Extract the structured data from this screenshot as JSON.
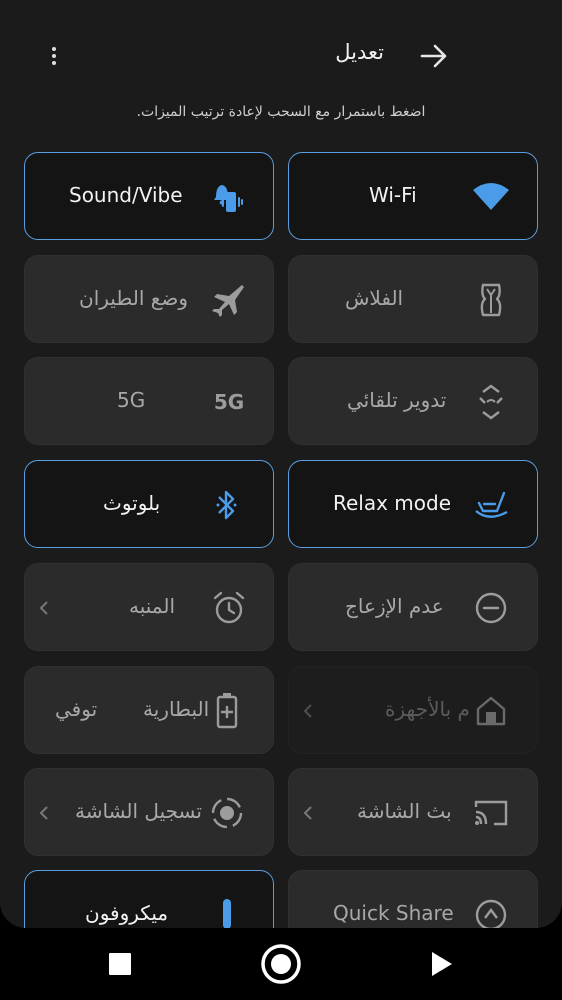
{
  "header": {
    "title": "تعديل",
    "hint": "اضغط باستمرار مع السحب لإعادة ترتيب الميزات."
  },
  "colors": {
    "accent": "#4a9be8",
    "active_border": "#5a9ee0"
  },
  "tiles": {
    "wifi": {
      "label": "Wi-Fi",
      "icon": "wifi-icon",
      "state": "active"
    },
    "sound": {
      "label": "Sound/Vibe",
      "icon": "sound-vibe-icon",
      "state": "active"
    },
    "flash": {
      "label": "الفلاش",
      "icon": "flashlight-icon",
      "state": "inactive"
    },
    "airplane": {
      "label": "وضع الطيران",
      "icon": "airplane-icon",
      "state": "inactive"
    },
    "rotate": {
      "label": "تدوير تلقائي",
      "icon": "auto-rotate-icon",
      "state": "inactive"
    },
    "fiveg": {
      "label": "5G",
      "icon_text": "5G",
      "icon": "5g-icon",
      "state": "inactive"
    },
    "relax": {
      "label": "Relax mode",
      "icon": "rocking-chair-icon",
      "state": "active"
    },
    "bluetooth": {
      "label": "بلوتوث",
      "icon": "bluetooth-icon",
      "state": "active"
    },
    "dnd": {
      "label": "عدم الإزعاج",
      "icon": "do-not-disturb-icon",
      "state": "inactive"
    },
    "alarm": {
      "label": "المنبه",
      "icon": "alarm-icon",
      "state": "inactive"
    },
    "devices": {
      "label": "م بالأجهزة",
      "icon": "home-icon",
      "state": "dimmed"
    },
    "battery": {
      "label": "البطارية",
      "label2": "توفي",
      "icon": "battery-plus-icon",
      "state": "inactive"
    },
    "cast": {
      "label": "بث الشاشة",
      "icon": "cast-icon",
      "state": "inactive"
    },
    "record": {
      "label": "تسجيل الشاشة",
      "icon": "screen-record-icon",
      "state": "inactive"
    },
    "quickshare": {
      "label": "Quick Share",
      "icon": "quick-share-icon",
      "state": "inactive"
    },
    "mic": {
      "label": "ميكروفون",
      "icon": "microphone-icon",
      "state": "active"
    }
  },
  "navbar": {
    "recents": "square-icon",
    "home": "circle-icon",
    "back": "triangle-icon"
  }
}
